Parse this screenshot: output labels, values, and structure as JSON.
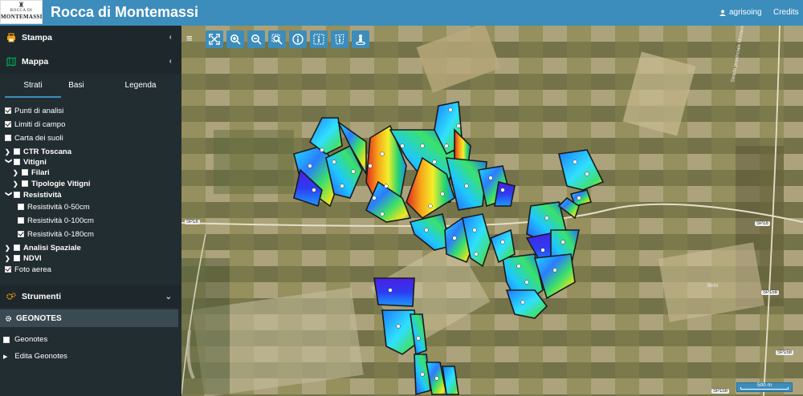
{
  "header": {
    "logo_line1": "ROCCA DI",
    "logo_line2": "MONTEMASSI",
    "title": "Rocca di Montemassi",
    "user": "agrisoing",
    "credits": "Credits"
  },
  "sidebar": {
    "stampa_label": "Stampa",
    "mappa_label": "Mappa",
    "tabs": [
      "Strati",
      "Basi",
      "Legenda"
    ],
    "layers": [
      {
        "label": "Punti di analisi",
        "checked": true
      },
      {
        "label": "Limiti di campo",
        "checked": true
      },
      {
        "label": "Carta dei suoli",
        "checked": false
      },
      {
        "label": "CTR Toscana",
        "checked": false
      },
      {
        "label": "Vitigni",
        "checked": false
      },
      {
        "label": "Filari",
        "checked": false
      },
      {
        "label": "Tipologie Vitigni",
        "checked": false
      },
      {
        "label": "Resistività",
        "checked": false
      },
      {
        "label": "Resistività 0-50cm",
        "checked": false
      },
      {
        "label": "Resistività 0-100cm",
        "checked": false
      },
      {
        "label": "Resistività 0-180cm",
        "checked": true
      },
      {
        "label": "Analisi Spaziale",
        "checked": false
      },
      {
        "label": "NDVI",
        "checked": false
      },
      {
        "label": "Foto aerea",
        "checked": true
      }
    ],
    "strumenti_label": "Strumenti",
    "geonotes_head": "GEONOTES",
    "geonotes_item": "Geonotes",
    "edita_item": "Edita Geonotes"
  },
  "map": {
    "toolbar_icons": [
      "zoom-extent-icon",
      "zoom-in-icon",
      "zoom-out-icon",
      "zoom-box-icon",
      "info-icon",
      "info-box-icon",
      "info-polygon-icon",
      "street-view-icon"
    ],
    "scale_label": "500 m",
    "road_labels": [
      "SP18",
      "SP18",
      "SP158",
      "SP158",
      "SP158",
      "Strada provinciale Montemassi"
    ],
    "place_label": "Bichi",
    "colors": {
      "accent": "#3c8dbc",
      "sidebar": "#222d32"
    }
  }
}
